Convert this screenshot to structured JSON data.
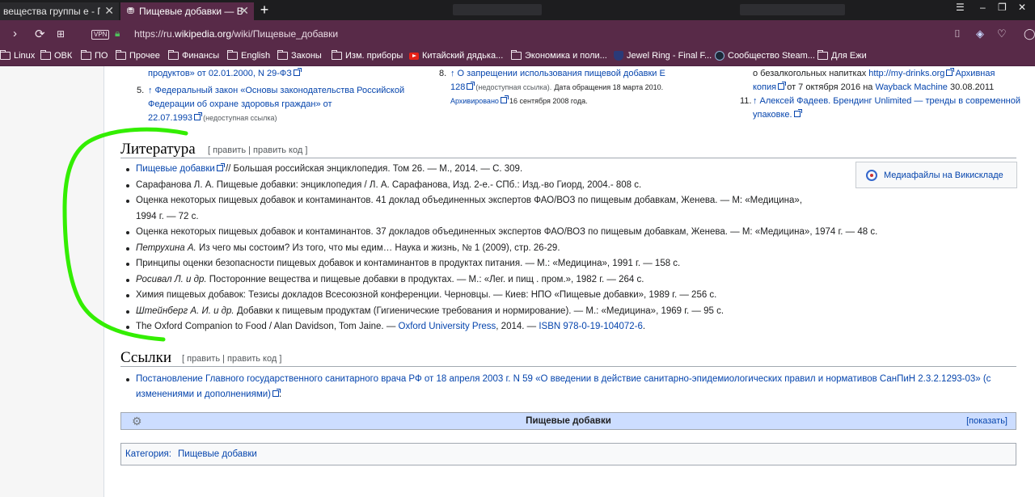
{
  "tabs": [
    {
      "title": "вещества группы е - Поис"
    },
    {
      "title": "Пищевые добавки — Викис"
    }
  ],
  "address": {
    "vpn": "VPN",
    "prefix": "https://ru.",
    "domain": "wikipedia.org",
    "path": "/wiki/Пищевые_добавки"
  },
  "bookmarks": [
    "Linux",
    "ОВК",
    "ПО",
    "Прочее",
    "Финансы",
    "English",
    "Законы",
    "Изм. приборы",
    "Китайский дядька...",
    "Экономика и поли...",
    "Jewel Ring - Final F...",
    "Сообщество Steam...",
    "Для Ежи"
  ],
  "refs": {
    "c1_top": "продуктов» от 02.01.2000, N 29-ФЗ",
    "c1_5_num": "5.",
    "c1_5_l1": "↑ Федеральный закон «Основы законодательства Российской",
    "c1_5_l2": "Федерации об охране здоровья граждан» от",
    "c1_5_l3": "22.07.1993",
    "c1_5_dead": "(недоступная ссылка)",
    "c2_8_num": "8.",
    "c2_8_l1": "↑ О запрещении использования пищевой добавки Е",
    "c2_8_l2": "128",
    "c2_8_dead": "(недоступная ссылка).",
    "c2_8_date": "Дата обращения 18 марта 2010.",
    "c2_8_arch": "Архивировано",
    "c2_8_archdate": "16 сентября 2008 года.",
    "c3_l1a": "о безалкогольных напитках",
    "c3_l1b": "http://my-drinks.org",
    "c3_l1c": "Архивная",
    "c3_l2a": "копия",
    "c3_l2b": "от 7 октября 2016 на",
    "c3_l2c": "Wayback Machine",
    "c3_l2d": "30.08.2011",
    "c3_11_num": "11.",
    "c3_11_l1": "↑ Алексей Фадеев. Брендинг Unlimited — тренды в современной",
    "c3_11_l2": "упаковке."
  },
  "literature": {
    "heading": "Литература",
    "edit": "[ править | править код ]",
    "items": [
      {
        "link": "Пищевые добавки",
        "text": " // Большая российская энциклопедия. Том 26. — М., 2014. — С. 309."
      },
      {
        "text": "Сарафанова Л. А. Пищевые добавки: энциклопедия / Л. А. Сарафанова, Изд. 2-е.- СПб.: Изд.-во Гиорд, 2004.- 808 с."
      },
      {
        "text": "Оценка некоторых пищевых добавок и контаминантов. 41 доклад объединенных экспертов ФАО/ВОЗ по пищевым добавкам, Женева. — М: «Медицина»,"
      },
      {
        "text": "1994 г. — 72 с."
      },
      {
        "text": "Оценка некоторых пищевых добавок и контаминантов. 37 докладов объединенных экспертов ФАО/ВОЗ по пищевым добавкам, Женева. — М: «Медицина», 1974 г. — 48 с."
      },
      {
        "italic": "Петрухина А.",
        "text": " Из чего мы состоим? Из того, что мы едим… Наука и жизнь, № 1 (2009), стр. 26-29."
      },
      {
        "text": "Принципы оценки безопасности пищевых добавок и контаминантов в продуктах питания. — М.: «Медицина», 1991 г. — 158 с."
      },
      {
        "italic": "Росивал Л. и др.",
        "text": " Посторонние вещества и пищевые добавки в продуктах. — М.: «Лег. и пищ . пром.», 1982 г. — 264 с."
      },
      {
        "text": "Химия пищевых добавок: Тезисы докладов Всесоюзной конференции. Черновцы. — Киев: НПО «Пищевые добавки», 1989 г. — 256 с."
      },
      {
        "italic": "Штейнберг А. И. и др.",
        "text": " Добавки к пищевым продуктам (Гигиенические требования и нормирование). — М.: «Медицина», 1969 г. — 95 с."
      },
      {
        "text": "The Oxford Companion to Food / Alan Davidson, Tom Jaine. — ",
        "link2": "Oxford University Press",
        "text2": ", 2014. — ",
        "link3": "ISBN 978-0-19-104072-6",
        "text3": "."
      }
    ],
    "media_label": "Медиафайлы на Викискладе"
  },
  "links": {
    "heading": "Ссылки",
    "edit": "[ править | править код ]",
    "item_l1": "Постановление Главного государственного санитарного врача РФ от 18 апреля 2003 г. N 59 «О введении в действие санитарно-эпидемиологических правил и нормативов СанПиН 2.3.2.1293-03» (с",
    "item_l2": "изменениями и дополнениями)"
  },
  "navbox": {
    "title": "Пищевые добавки",
    "show": "[показать]"
  },
  "category": {
    "label": "Категория:",
    "value": "Пищевые добавки"
  },
  "colors": {
    "accent": "#582a48",
    "link": "#0645ad",
    "annotation": "#33ee00"
  }
}
